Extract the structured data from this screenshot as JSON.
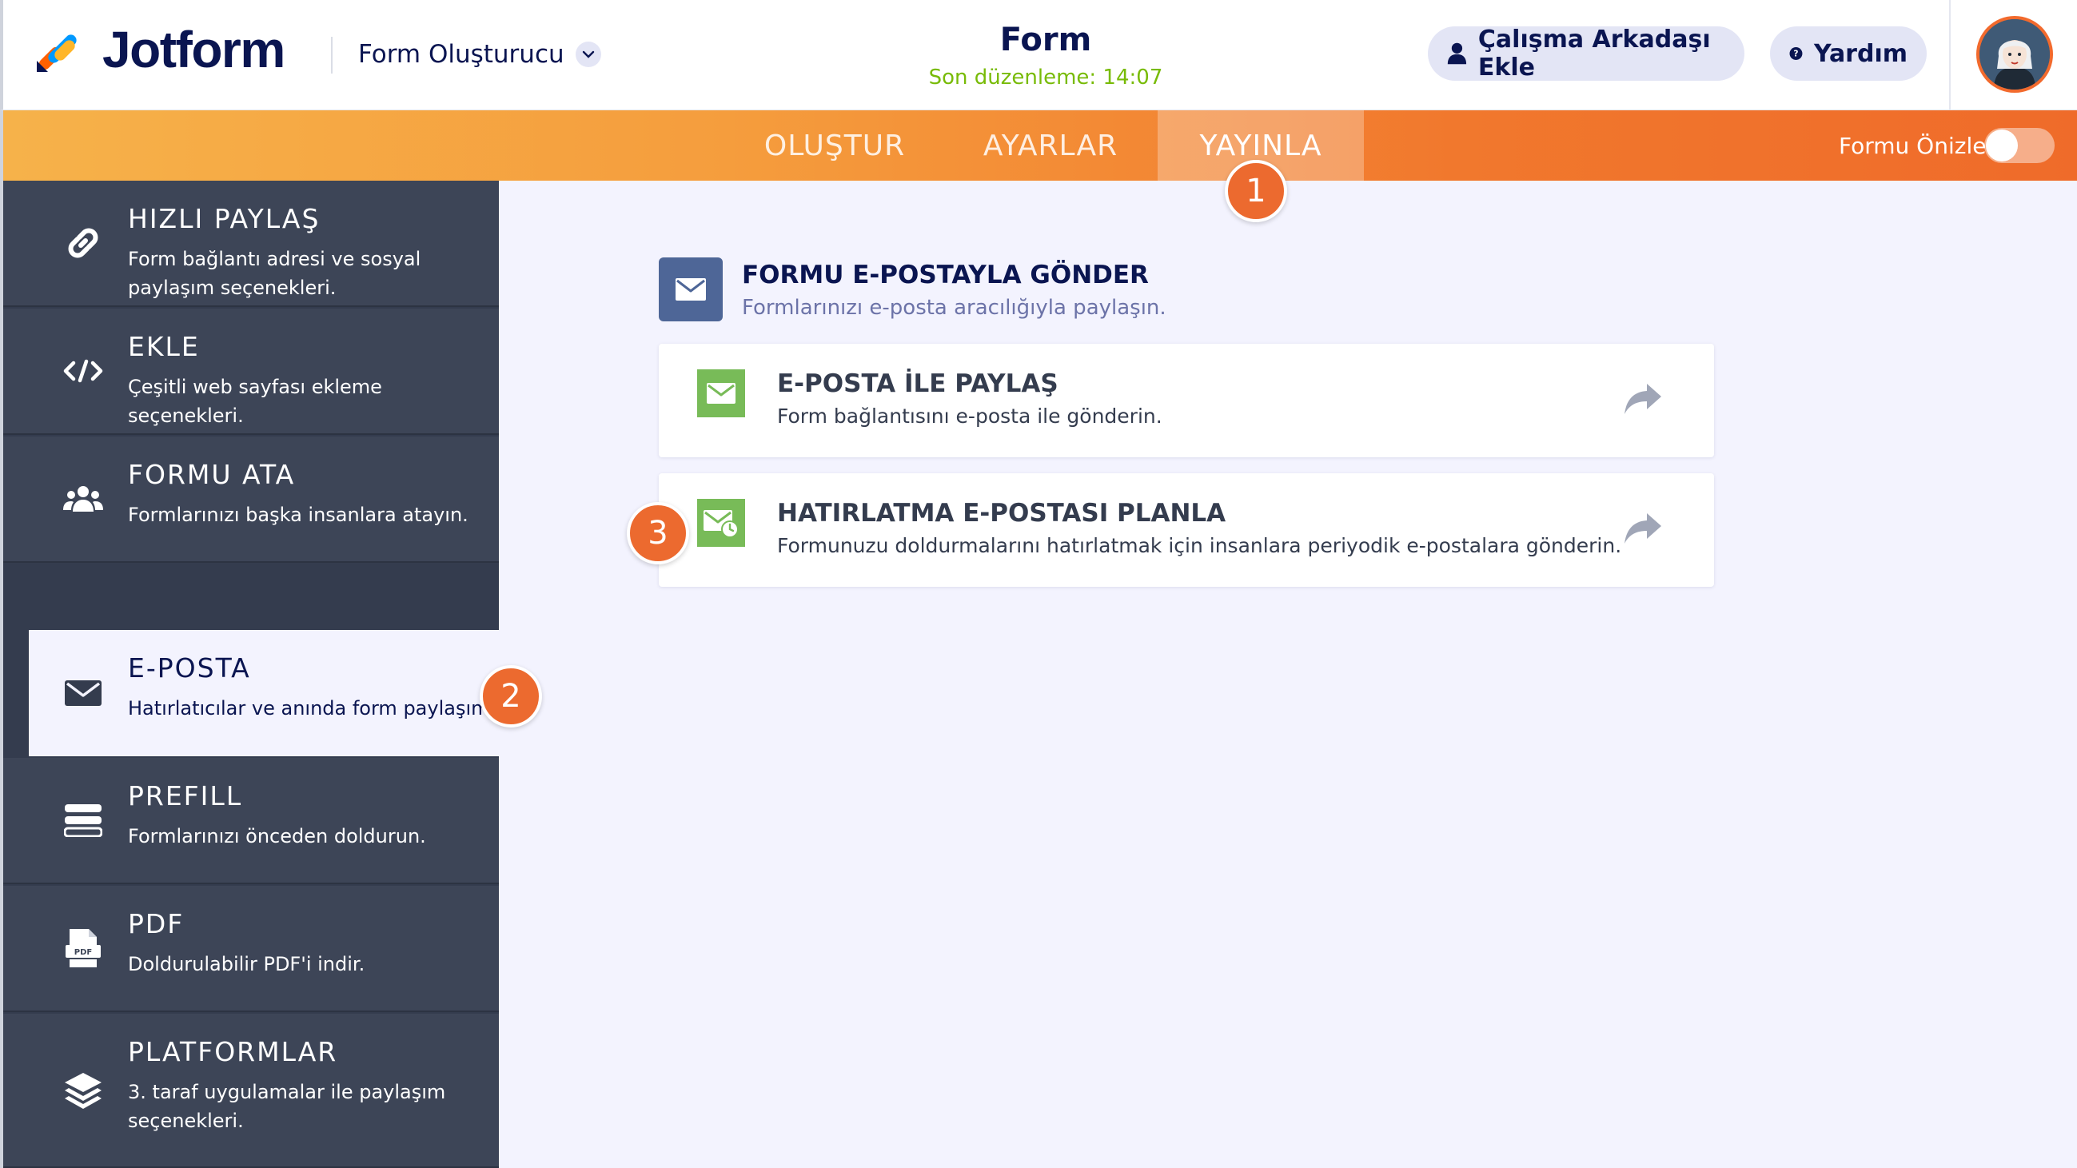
{
  "brand": {
    "name": "Jotform"
  },
  "header": {
    "builder_menu": "Form Oluşturucu",
    "form_title": "Form",
    "last_edited": "Son düzenleme: 14:07",
    "add_collaborator": "Çalışma Arkadaşı Ekle",
    "help": "Yardım"
  },
  "nav": {
    "tabs": [
      {
        "label": "OLUŞTUR"
      },
      {
        "label": "AYARLAR"
      },
      {
        "label": "YAYINLA"
      }
    ],
    "active_tab": "YAYINLA",
    "preview_label": "Formu Önizle",
    "preview_enabled": false
  },
  "badges": [
    "1",
    "2",
    "3"
  ],
  "sidebar": {
    "items": [
      {
        "title": "HIZLI PAYLAŞ",
        "desc": "Form bağlantı adresi ve sosyal paylaşım seçenekleri.",
        "icon": "link-icon"
      },
      {
        "title": "EKLE",
        "desc": "Çeşitli web sayfası ekleme seçenekleri.",
        "icon": "code-icon"
      },
      {
        "title": "FORMU ATA",
        "desc": "Formlarınızı başka insanlara atayın.",
        "icon": "users-icon"
      },
      {
        "title": "E-POSTA",
        "desc": "Hatırlatıcılar ve anında form paylaşımı",
        "icon": "envelope-icon",
        "active": true
      },
      {
        "title": "PREFILL",
        "desc": "Formlarınızı önceden doldurun.",
        "icon": "prefill-icon"
      },
      {
        "title": "PDF",
        "desc": "Doldurulabilir PDF'i indir.",
        "icon": "pdf-icon"
      },
      {
        "title": "PLATFORMLAR",
        "desc": "3. taraf uygulamalar ile paylaşım seçenekleri.",
        "icon": "layers-icon"
      }
    ]
  },
  "main": {
    "section_title": "FORMU E-POSTAYLA GÖNDER",
    "section_subtitle": "Formlarınızı e-posta aracılığıyla paylaşın.",
    "cards": [
      {
        "title": "E-POSTA İLE PAYLAŞ",
        "desc": "Form bağlantısını e-posta ile gönderin."
      },
      {
        "title": "HATIRLATMA E-POSTASI PLANLA",
        "desc": "Formunuzu doldurmalarını hatırlatmak için insanlara periyodik e-postalara gönderin."
      }
    ]
  },
  "colors": {
    "accent_orange": "#ec6a2f",
    "navy": "#0a1551",
    "sidebar_bg": "#3d4557",
    "green": "#78bb58",
    "last_edit_green": "#78bb07",
    "section_icon_blue": "#4e6697"
  }
}
